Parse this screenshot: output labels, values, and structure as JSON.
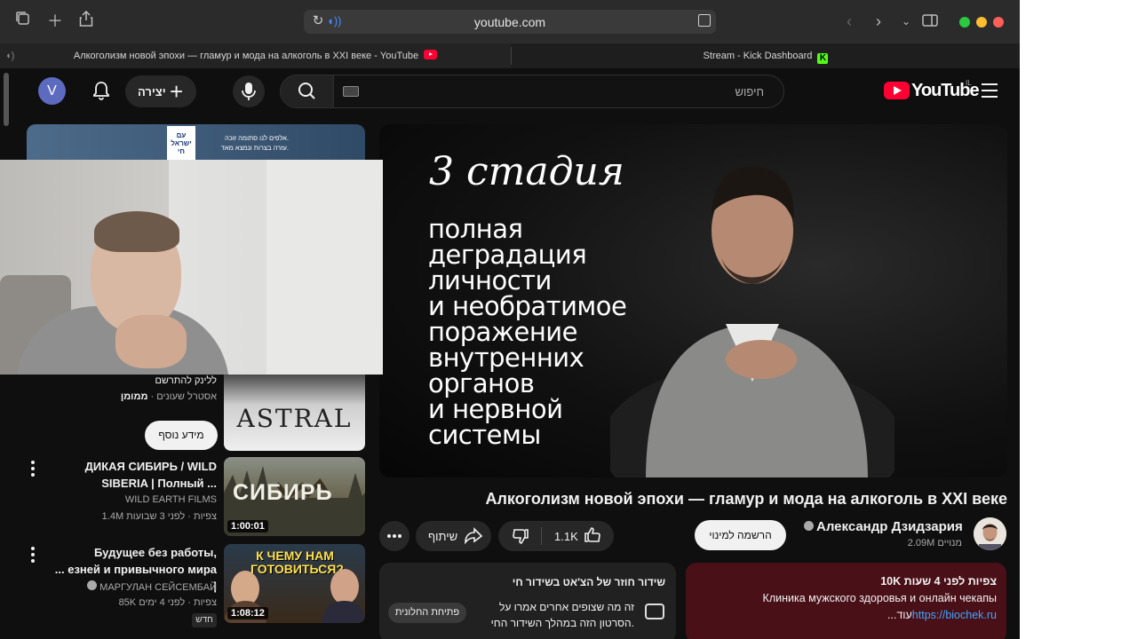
{
  "browser": {
    "url": "youtube.com",
    "tabs": [
      {
        "label": "Алкоголизм новой эпохи — гламур и мода на алкоголь в XXI веке - YouTube",
        "active": true
      },
      {
        "label": "Stream - Kick Dashboard",
        "active": false
      }
    ]
  },
  "header": {
    "avatar_letter": "V",
    "create_label": "יצירה",
    "search_placeholder": "חיפוש",
    "logo_text": "YouTube",
    "logo_country": "IL"
  },
  "video": {
    "overlay_title": "3 стадия",
    "overlay_lines": [
      "полная",
      "деградация",
      "личности",
      "и необратимое",
      "поражение",
      "внутренних",
      "органов",
      "и нервной",
      "системы"
    ],
    "title": "Алкоголизм новой эпохи — гламур и мода на алкоголь в XXI веке",
    "likes": "1.1K",
    "share_label": "שיתוף",
    "subscribe_label": "הרשמה למינוי",
    "channel_name": "Александр Дзидзария",
    "channel_subs": "2.09M מנויים"
  },
  "description": {
    "stats": "10K צפיות  לפני 4 שעות",
    "line1": "Клиника мужского здоровья  и онлайн чекапы",
    "link": "https://biochek.ru",
    "more": "...עוד"
  },
  "chat_notice": {
    "title": "שידור חוזר של הצ'אט בשידור חי",
    "line1": "זה מה שצופים אחרים אמרו על",
    "line2": "הסרטון הזה במהלך השידור החי.",
    "open_button": "פתיחת החלונית"
  },
  "ad": {
    "banner_flag_text": "עם ישראל חי",
    "banner_line1": "אלפים לנו סתומה זוכה.",
    "banner_line2": "עזרה בצרות ונמצא מאד.",
    "line1": "ללינק להתרשם",
    "sponsored": "ממומן",
    "advertiser": "אסטרל שעונים",
    "thumb_text": "ASTRAL",
    "more_info_button": "מידע נוסף"
  },
  "recommendations": [
    {
      "title_line1": "ДИКАЯ СИБИРЬ / WILD",
      "title_line2": "SIBERIA | Полный ...",
      "channel": "WILD EARTH FILMS",
      "meta": "1.4M צפיות  ·  לפני 3 שבועות",
      "duration": "1:00:01",
      "thumb_text": "СИБИРЬ"
    },
    {
      "title_line1": "Будущее без работы,",
      "title_line2": "...  езней и привычного мира |",
      "channel": "МАРГУЛАН СЕЙСЕМБАЙ",
      "meta": "85K צפיות  ·  לפני 4 ימים",
      "duration": "1:08:12",
      "badge": "חדש",
      "thumb_text": "К ЧЕМУ НАМ ГОТОВИТЬСЯ?"
    }
  ],
  "colors": {
    "yt_red": "#ff0033",
    "kick_green": "#53fc18",
    "background": "#0f0f0f",
    "desc_box": "#4a1018"
  }
}
